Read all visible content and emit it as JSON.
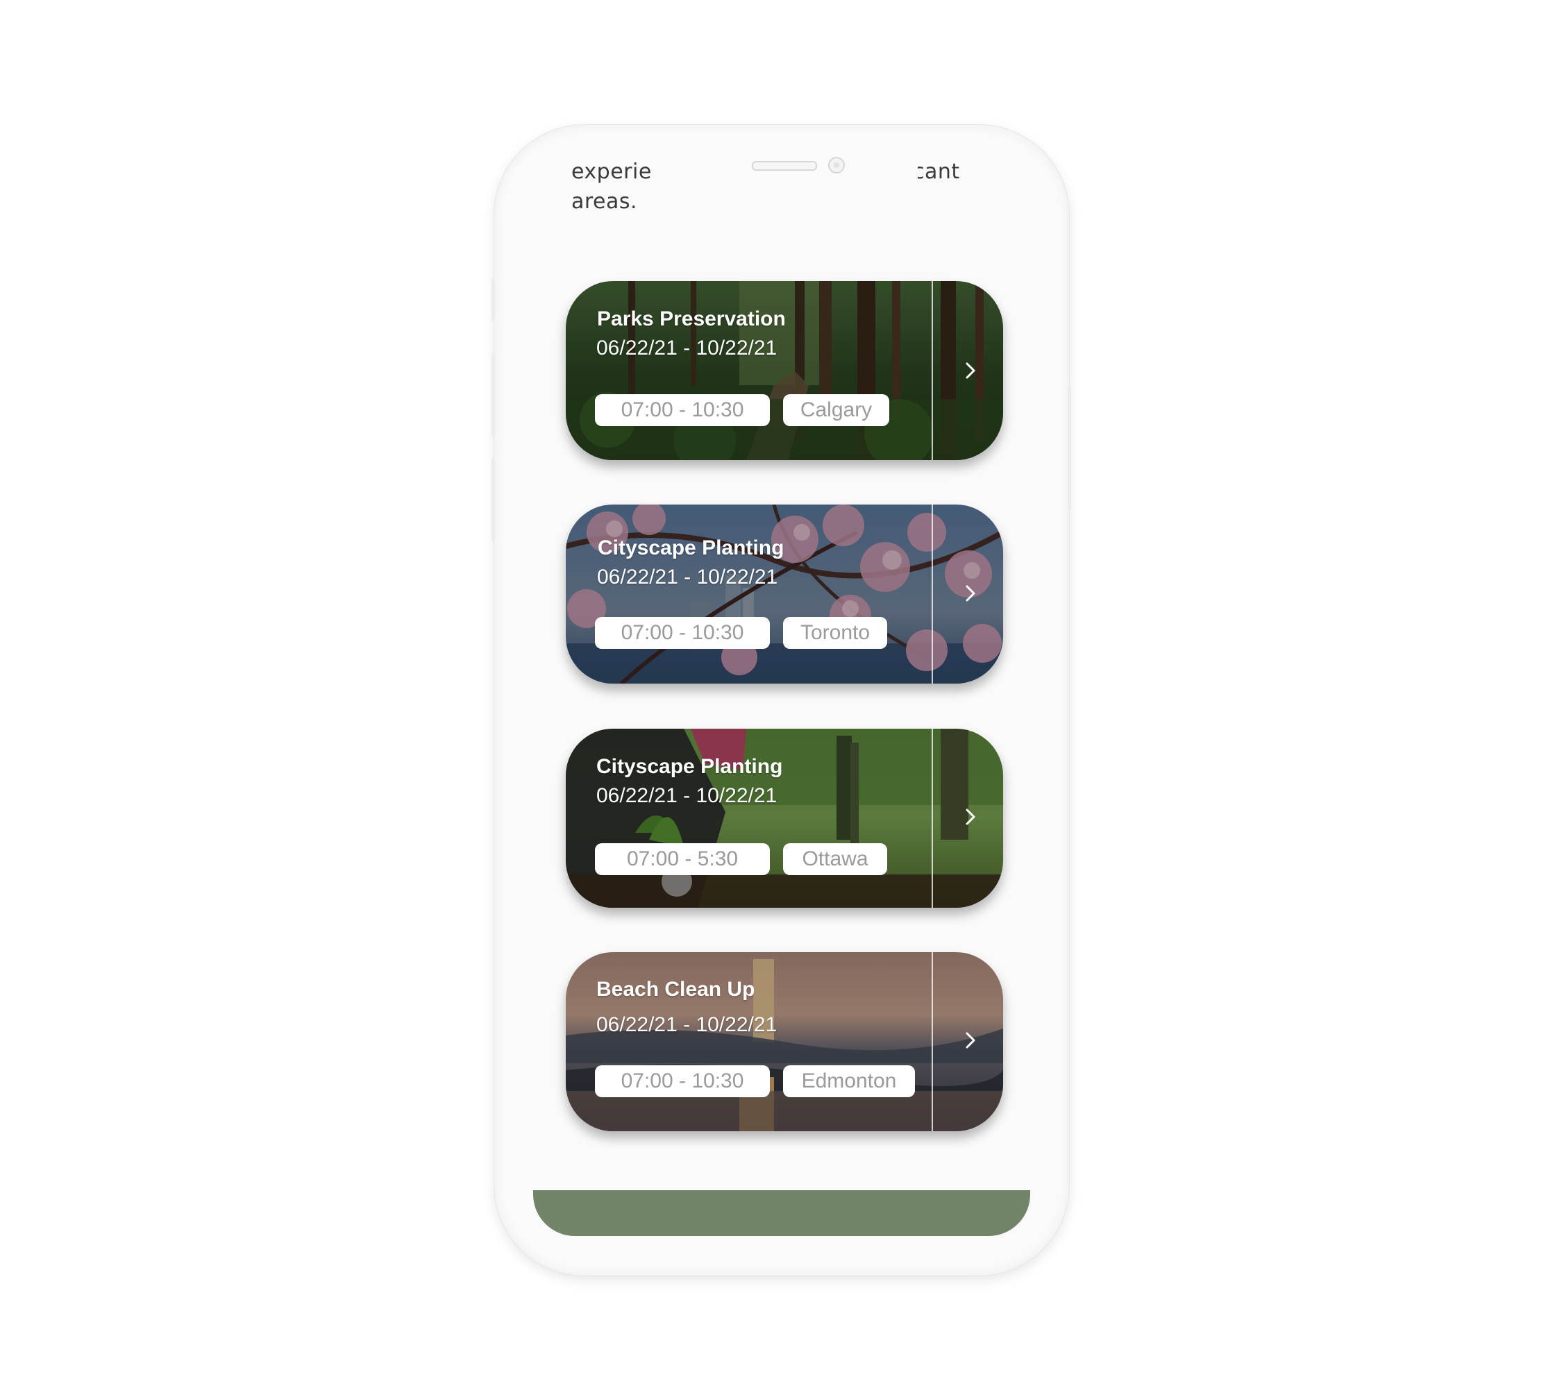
{
  "intro": {
    "line1_left": "experie",
    "line1_right": "cant",
    "line2": "areas."
  },
  "events": [
    {
      "title": "Parks Preservation",
      "dates": "06/22/21 - 10/22/21",
      "time": "07:00 - 10:30",
      "city": "Calgary",
      "scene": "forest"
    },
    {
      "title": "Cityscape Planting",
      "dates": "06/22/21 - 10/22/21",
      "time": "07:00 - 10:30",
      "city": "Toronto",
      "scene": "cherry-blossom-city"
    },
    {
      "title": "Cityscape Planting",
      "dates": "06/22/21 - 10/22/21",
      "time": "07:00 - 5:30",
      "city": "Ottawa",
      "scene": "tree-planting"
    },
    {
      "title": "Beach Clean Up",
      "dates": "06/22/21 - 10/22/21",
      "time": "07:00 - 10:30",
      "city": "Edmonton",
      "scene": "sunset-beach"
    }
  ],
  "icons": {
    "card_action": "chevron-right-icon"
  },
  "colors": {
    "bottom_bar": "#728467",
    "pill_background": "#ffffff",
    "pill_text": "#9a9a9a",
    "card_text": "#ffffff"
  }
}
